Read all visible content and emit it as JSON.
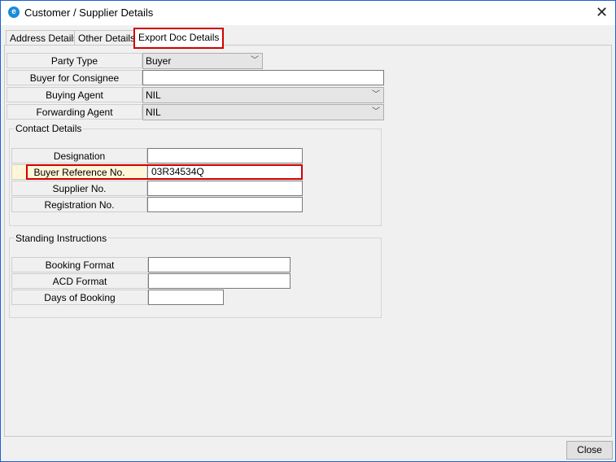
{
  "window": {
    "title": "Customer / Supplier Details"
  },
  "tabs": [
    {
      "label": "Address Details"
    },
    {
      "label": "Other Details"
    },
    {
      "label": "Export Doc Details"
    }
  ],
  "party": {
    "party_type_label": "Party Type",
    "party_type_value": "Buyer",
    "buyer_consignee_label": "Buyer for Consignee",
    "buyer_consignee_value": "",
    "buying_agent_label": "Buying Agent",
    "buying_agent_value": "NIL",
    "forwarding_agent_label": "Forwarding Agent",
    "forwarding_agent_value": "NIL"
  },
  "contact": {
    "title": "Contact Details",
    "designation_label": "Designation",
    "designation_value": "",
    "buyer_ref_label": "Buyer Reference No.",
    "buyer_ref_value": "03R34534Q",
    "supplier_label": "Supplier No.",
    "supplier_value": "",
    "registration_label": "Registration No.",
    "registration_value": ""
  },
  "standing": {
    "title": "Standing Instructions",
    "booking_format_label": "Booking Format",
    "booking_format_value": "",
    "acd_format_label": "ACD Format",
    "acd_format_value": "",
    "days_booking_label": "Days of Booking",
    "days_booking_value": ""
  },
  "footer": {
    "close_label": "Close"
  },
  "colors": {
    "highlight": "#d00000",
    "window_border": "#1a63d1"
  }
}
